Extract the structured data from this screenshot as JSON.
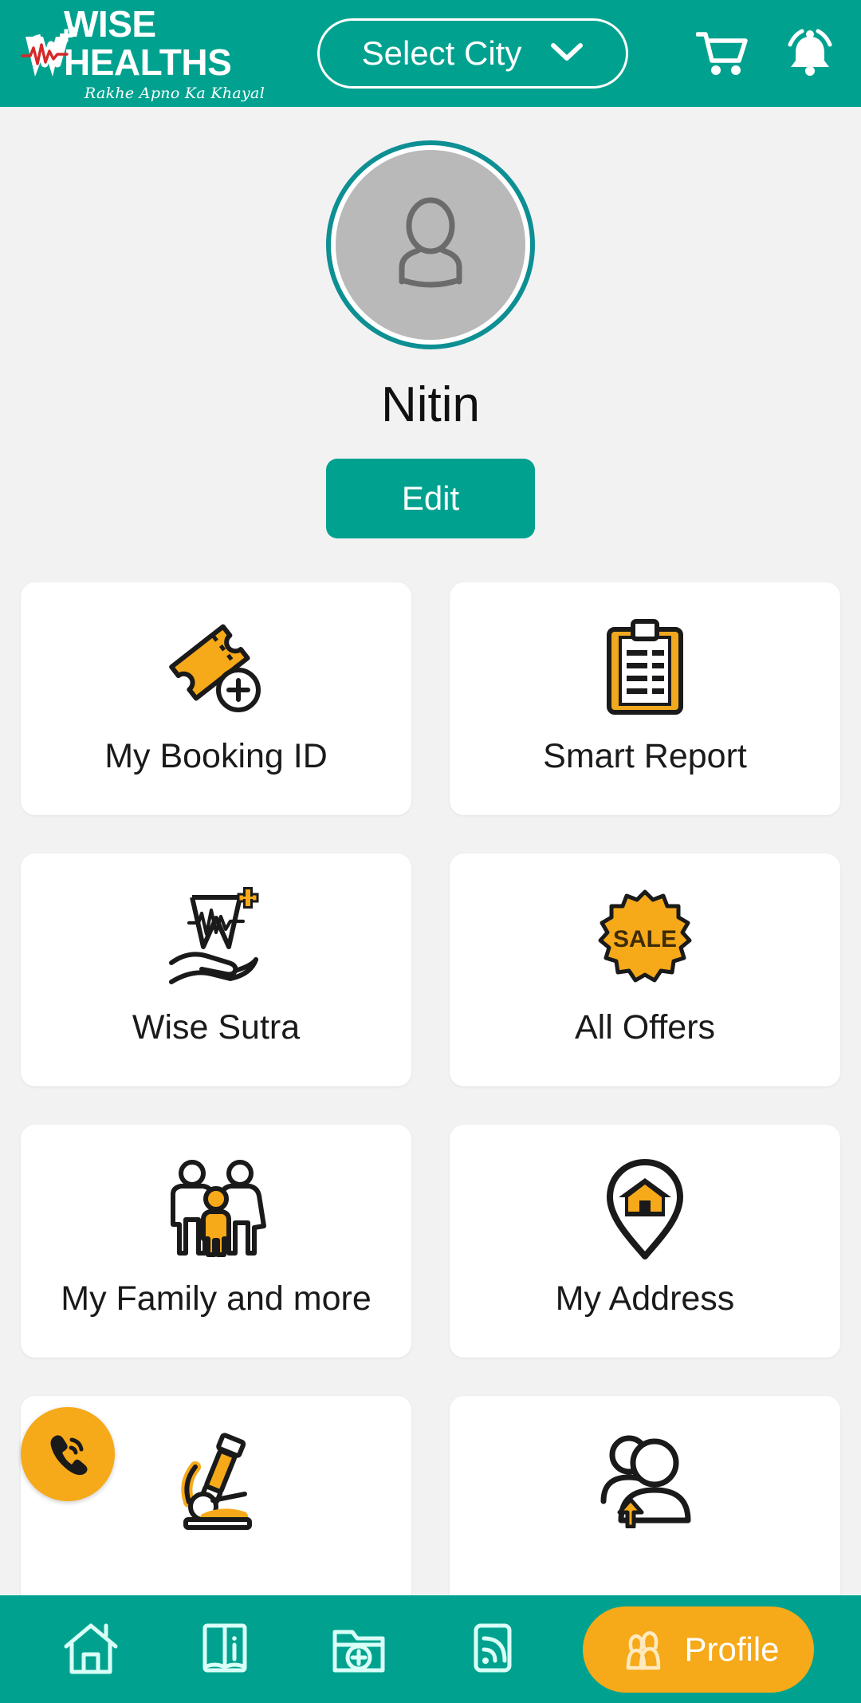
{
  "header": {
    "brand_name": "WISE HEALTHS",
    "brand_tagline": "Rakhe Apno Ka Khayal",
    "city_selector_label": "Select City",
    "chevron_icon": "chevron-down-icon",
    "cart_icon": "shopping-cart-icon",
    "bell_icon": "notification-bell-icon",
    "background_color": "#00a28f"
  },
  "profile": {
    "avatar_icon": "user-avatar-placeholder-icon",
    "user_name": "Nitin",
    "edit_label": "Edit",
    "ring_color": "#0d8f93",
    "edit_button_color": "#00a28f"
  },
  "grid": {
    "cards": [
      {
        "label": "My Booking ID",
        "icon": "ticket-add-icon"
      },
      {
        "label": "Smart Report",
        "icon": "clipboard-report-icon"
      },
      {
        "label": "Wise Sutra",
        "icon": "hand-heartbeat-icon"
      },
      {
        "label": "All Offers",
        "icon": "sale-badge-icon"
      },
      {
        "label": "My Family and more",
        "icon": "family-group-icon"
      },
      {
        "label": "My Address",
        "icon": "map-pin-home-icon"
      },
      {
        "label": "",
        "icon": "microscope-icon"
      },
      {
        "label": "",
        "icon": "switch-user-icon"
      }
    ],
    "accent_color": "#f6a919"
  },
  "floating_action": {
    "icon": "phone-call-icon",
    "color": "#f6a919"
  },
  "bottom_nav": {
    "items": [
      {
        "label": "",
        "icon": "home-icon",
        "active": false
      },
      {
        "label": "",
        "icon": "book-info-icon",
        "active": false
      },
      {
        "label": "",
        "icon": "folder-add-icon",
        "active": false
      },
      {
        "label": "",
        "icon": "feed-rss-icon",
        "active": false
      },
      {
        "label": "Profile",
        "icon": "profile-people-icon",
        "active": true
      }
    ],
    "active_color": "#f6a919",
    "background_color": "#00a28f"
  }
}
